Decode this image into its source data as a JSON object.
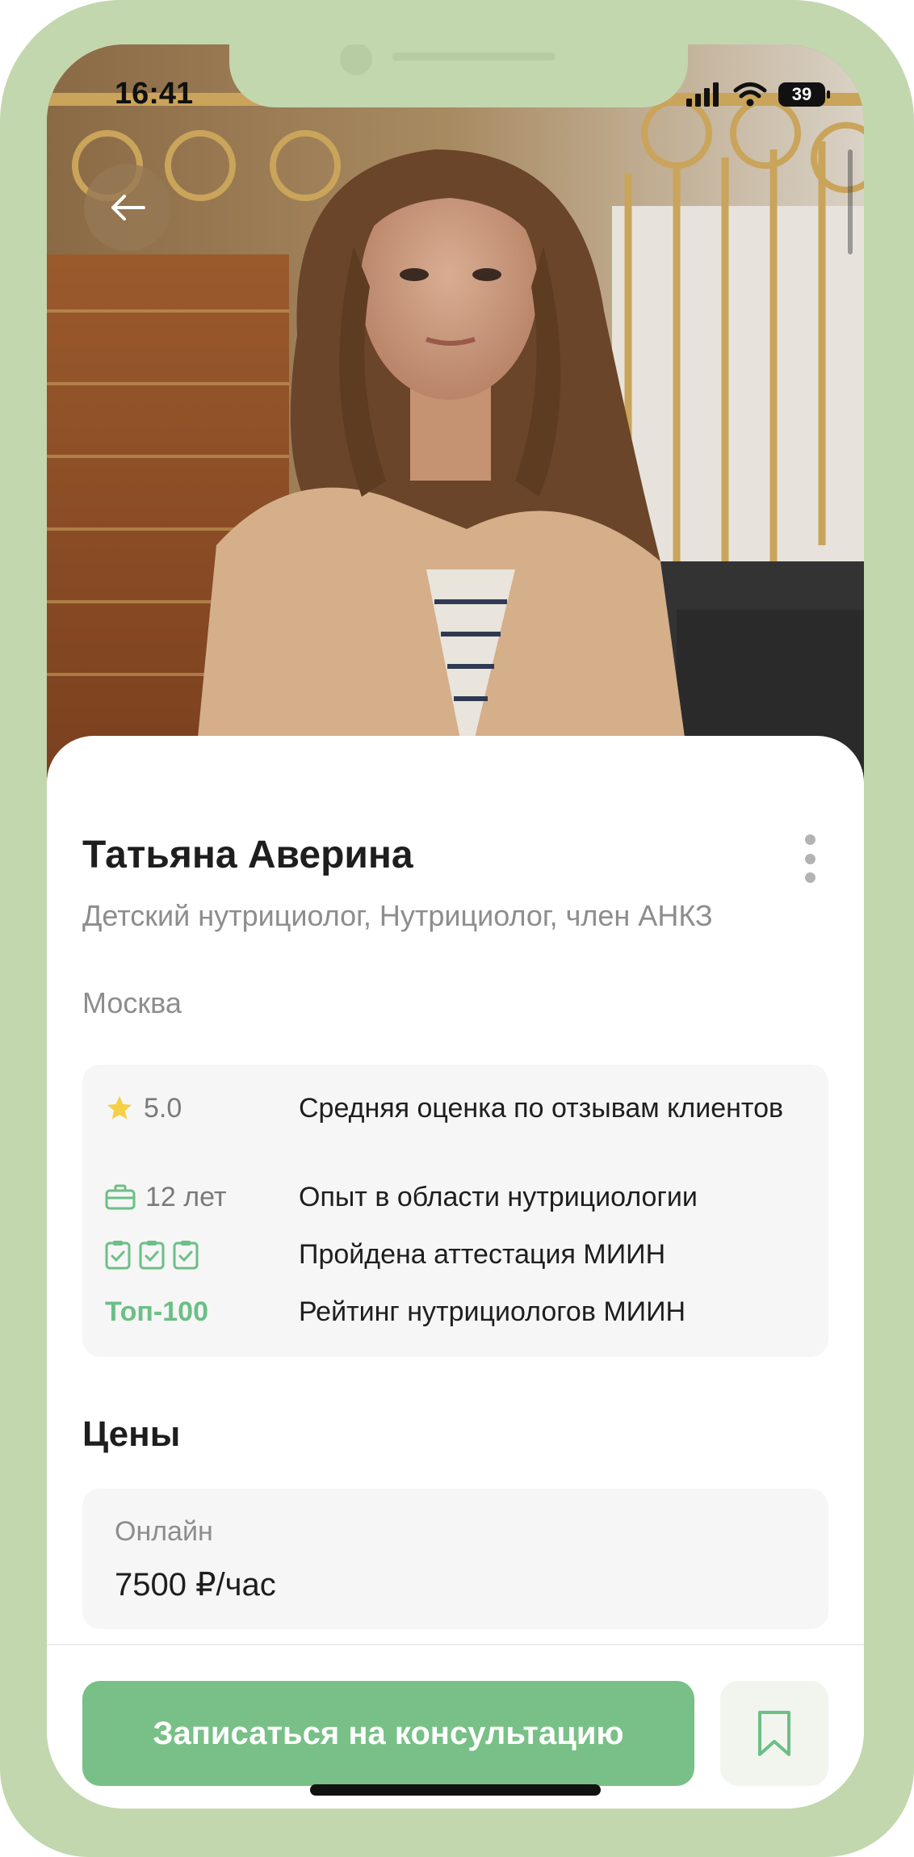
{
  "status_bar": {
    "time": "16:41",
    "battery": "39"
  },
  "profile": {
    "name": "Татьяна Аверина",
    "specialty": "Детский нутрициолог, Нутрициолог, член АНКЗ",
    "city": "Москва"
  },
  "stats": [
    {
      "icon": "star-icon",
      "value": "5.0",
      "label": "Средняя оценка по отзывам клиентов"
    },
    {
      "icon": "briefcase-icon",
      "value": "12 лет",
      "label": "Опыт в области нутрициологии"
    },
    {
      "icon": "certificate-icons",
      "value": "",
      "label": "Пройдена аттестация МИИН"
    },
    {
      "icon": "",
      "value": "Топ-100",
      "label": "Рейтинг нутрициологов МИИН"
    }
  ],
  "prices": {
    "title": "Цены",
    "items": [
      {
        "label": "Онлайн",
        "value": "7500 ₽/час"
      }
    ]
  },
  "actions": {
    "book_label": "Записаться на консультацию"
  },
  "colors": {
    "accent": "#78c087",
    "frame": "#c2d7ae",
    "top_badge": "#6cbf86",
    "star": "#f5cf45"
  }
}
